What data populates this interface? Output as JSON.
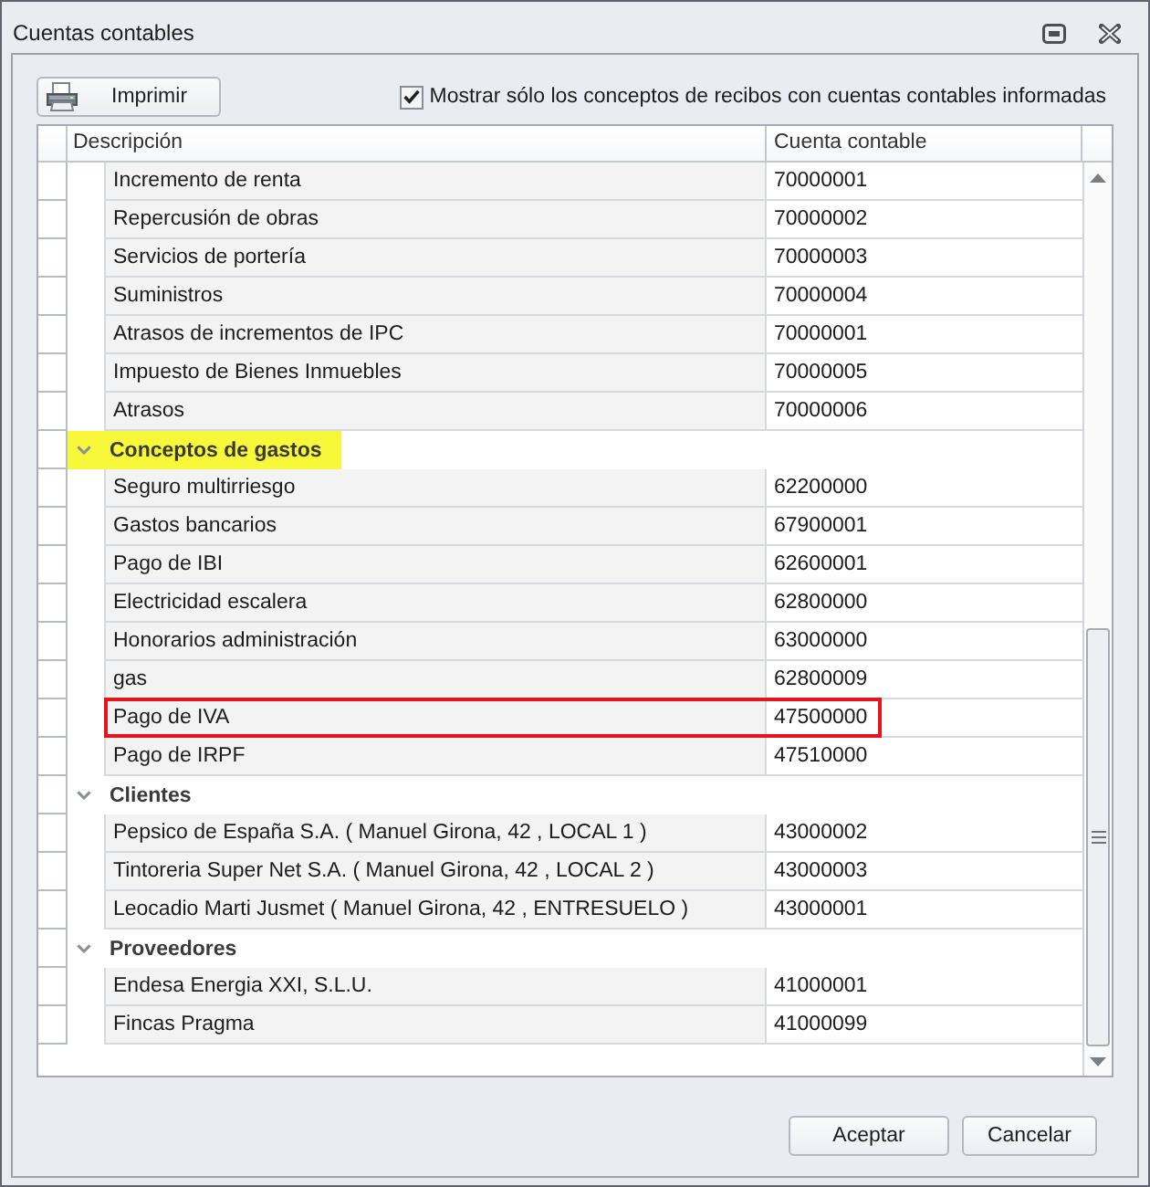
{
  "window": {
    "title": "Cuentas contables"
  },
  "toolbar": {
    "print_button": "Imprimir",
    "filter_checkbox": {
      "label": "Mostrar sólo los conceptos de recibos con cuentas contables informadas",
      "checked": true
    }
  },
  "table": {
    "columns": [
      "Descripción",
      "Cuenta contable"
    ],
    "groups": [
      {
        "children": [
          {
            "description": "Incremento de renta",
            "account": "70000001",
            "outlined": false
          },
          {
            "description": "Repercusión de obras",
            "account": "70000002",
            "outlined": false
          },
          {
            "description": "Servicios de portería",
            "account": "70000003",
            "outlined": false
          },
          {
            "description": "Suministros",
            "account": "70000004",
            "outlined": false
          },
          {
            "description": "Atrasos de incrementos de IPC",
            "account": "70000001",
            "outlined": false
          },
          {
            "description": "Impuesto de Bienes Inmuebles",
            "account": "70000005",
            "outlined": false
          },
          {
            "description": "Atrasos",
            "account": "70000006",
            "outlined": false
          }
        ]
      },
      {
        "label": "Conceptos de gastos",
        "expanded": true,
        "highlighted": true,
        "children": [
          {
            "description": "Seguro multirriesgo",
            "account": "62200000",
            "outlined": false
          },
          {
            "description": "Gastos bancarios",
            "account": "67900001",
            "outlined": false
          },
          {
            "description": "Pago de IBI",
            "account": "62600001",
            "outlined": false
          },
          {
            "description": "Electricidad escalera",
            "account": "62800000",
            "outlined": false
          },
          {
            "description": "Honorarios administración",
            "account": "63000000",
            "outlined": false
          },
          {
            "description": "gas",
            "account": "62800009",
            "outlined": false
          },
          {
            "description": "Pago de IVA",
            "account": "47500000",
            "outlined": true
          },
          {
            "description": "Pago de IRPF",
            "account": "47510000",
            "outlined": false
          }
        ]
      },
      {
        "label": "Clientes",
        "expanded": true,
        "highlighted": false,
        "children": [
          {
            "description": "Pepsico de España S.A. ( Manuel Girona, 42 , LOCAL 1 )",
            "account": "43000002",
            "outlined": false
          },
          {
            "description": "Tintoreria Super Net S.A. ( Manuel Girona, 42 , LOCAL 2 )",
            "account": "43000003",
            "outlined": false
          },
          {
            "description": "Leocadio Marti Jusmet ( Manuel Girona, 42 , ENTRESUELO )",
            "account": "43000001",
            "outlined": false
          }
        ]
      },
      {
        "label": "Proveedores",
        "expanded": true,
        "highlighted": false,
        "children": [
          {
            "description": "Endesa Energia XXI, S.L.U.",
            "account": "41000001",
            "outlined": false
          },
          {
            "description": "Fincas Pragma",
            "account": "41000099",
            "outlined": false
          }
        ]
      }
    ]
  },
  "buttons": [
    "Aceptar",
    "Cancelar"
  ]
}
